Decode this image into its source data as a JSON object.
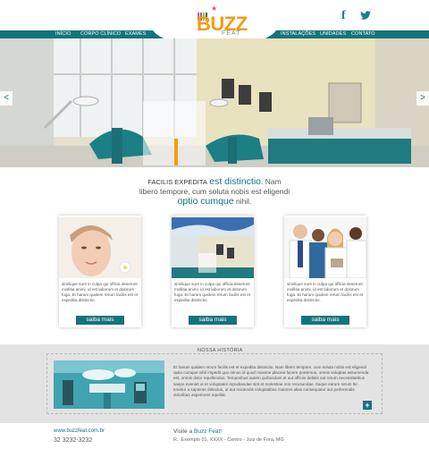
{
  "brand": {
    "name": "BUZZ",
    "tagline": "FEAT"
  },
  "nav": {
    "left": [
      "INÍCIO",
      "CORPO CLÍNICO",
      "EXAMES"
    ],
    "right": [
      "INSTALAÇÕES",
      "UNIDADES",
      "CONTATO"
    ]
  },
  "hero": {
    "prev": "<",
    "next": ">"
  },
  "intro": {
    "caps": "FACILIS EXPEDITA",
    "emph1": "est distinctio",
    "line1_end": ". Nam",
    "line2": "libero tempore, cum soluta nobis est eligendi",
    "emph2": "optio cumque",
    "line3_end": " nihil."
  },
  "cards": [
    {
      "text": "similique sunt in culpa qui officia deserunt mollitia animi, id est laborum et dolorum fuga. Et harum quidem rerum facilis est et expedita distinctio.",
      "button": "saiba mais"
    },
    {
      "text": "similique sunt in culpa qui officia deserunt mollitia animi, id est laborum et dolorum fuga. Et harum quidem rerum facilis est et expedita distinctio.",
      "button": "saiba mais"
    },
    {
      "text": "similique sunt in culpa qui officia deserunt mollitia animi, id est laborum et dolorum fuga. Et harum quidem rerum facilis est et expedita distinctio.",
      "button": "saiba mais"
    }
  ],
  "history": {
    "label": "NOSSA HISTÓRIA",
    "text": "Et harum quidem rerum facilis est et expedita distinctio. Nam libero tempore, cum soluta nobis est eligendi optio cumque nihil impedit quo minus id quod maxime placeat facere possimus, omnis voluptas assumenda est, omnis dolor repellendus. Temporibus autem quibusdam et aut officiis debitis aut rerum necessitatibus saepe eveniet ut et voluptates repudiandae sint et molestiae non recusandae. Itaque earum rerum hic tenetur a sapiente delectus, ut aut reiciendis voluptatibus maiores alias consequatur aut perferendis doloribus asperiores repellat.",
    "more": "+"
  },
  "footer": {
    "site": "www.buzzfeat.com.br",
    "phone": "32 3232-3232",
    "visit_prefix": "Visite a ",
    "visit_brand": "Buzz Feat!",
    "address": "R.: Exemplo 01, XXXX - Centro - Juiz de Fora, MG"
  },
  "colors": {
    "accent": "#14747c",
    "logo": "#f39c12"
  },
  "icons": {
    "facebook": "facebook-icon",
    "twitter": "twitter-icon"
  }
}
